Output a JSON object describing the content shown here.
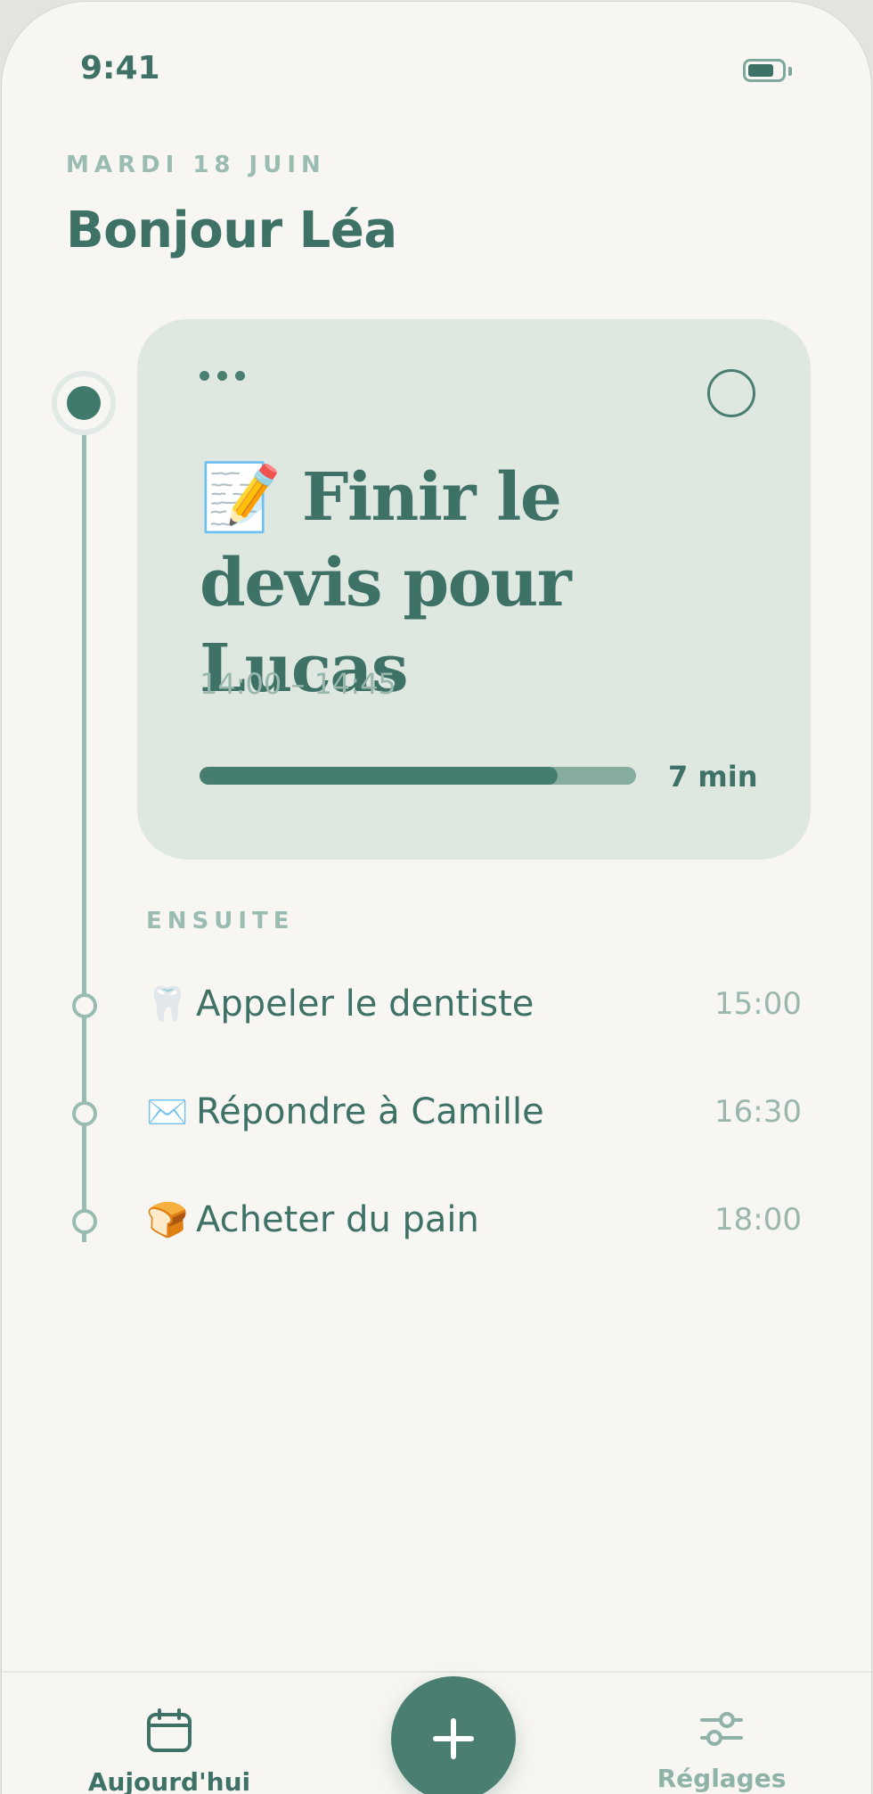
{
  "status_bar": {
    "time": "9:41",
    "battery_icon": "battery-icon"
  },
  "header": {
    "date": "MARDI 18 JUIN",
    "greeting": "Bonjour Léa"
  },
  "current_task": {
    "emoji": "📝",
    "title": "Finir le devis pour Lucas",
    "time_range": "14:00 – 14:45",
    "remaining": "7 min",
    "progress_fraction": 0.82,
    "menu_icon": "more-horizontal-icon",
    "complete_icon": "check-circle-icon"
  },
  "next_section": {
    "label": "ENSUITE",
    "tasks": [
      {
        "emoji": "🦷",
        "name": "Appeler le dentiste",
        "time": "15:00"
      },
      {
        "emoji": "✉️",
        "name": "Répondre à Camille",
        "time": "16:30"
      },
      {
        "emoji": "🍞",
        "name": "Acheter du pain",
        "time": "18:00"
      }
    ]
  },
  "tab_bar": {
    "today": {
      "label": "Aujourd'hui",
      "icon": "calendar-icon"
    },
    "add": {
      "icon": "plus-icon"
    },
    "settings": {
      "label": "Réglages",
      "icon": "sliders-icon"
    }
  },
  "colors": {
    "accent": "#3f7267",
    "accent_soft": "#98bcb2",
    "card_bg": "#dfe7e1",
    "background": "#f8f6f2"
  }
}
